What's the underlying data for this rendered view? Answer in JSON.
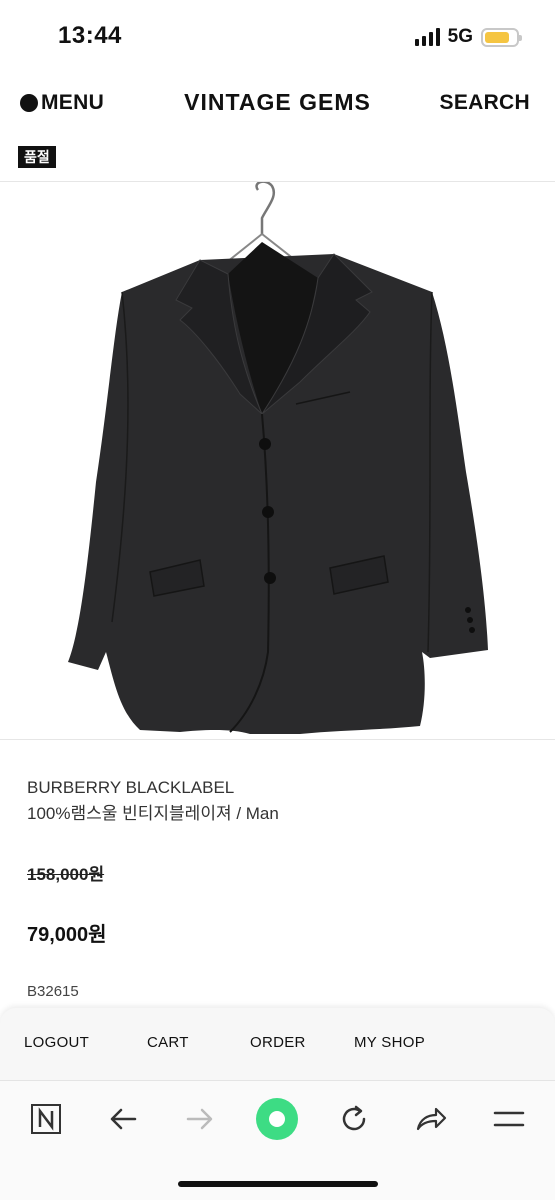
{
  "status_bar": {
    "time": "13:44",
    "network": "5G",
    "battery_level": 0.8,
    "battery_color": "#f5c542"
  },
  "header": {
    "menu_label": "MENU",
    "logo": "VINTAGE GEMS",
    "search_label": "SEARCH"
  },
  "product": {
    "status_badge": "품절",
    "brand": "BURBERRY BLACKLABEL",
    "name": "100%램스울 빈티지블레이져 / Man",
    "original_price": "158,000원",
    "sale_price": "79,000원",
    "sku": "B32615"
  },
  "bottom_menu": {
    "items": [
      "LOGOUT",
      "CART",
      "ORDER",
      "MY SHOP"
    ]
  },
  "browser_toolbar": {
    "buttons": [
      "n-logo-icon",
      "back-arrow-icon",
      "forward-arrow-icon",
      "green-circle-icon",
      "reload-icon",
      "share-icon",
      "hamburger-icon"
    ],
    "accent_color": "#3ddc84"
  }
}
